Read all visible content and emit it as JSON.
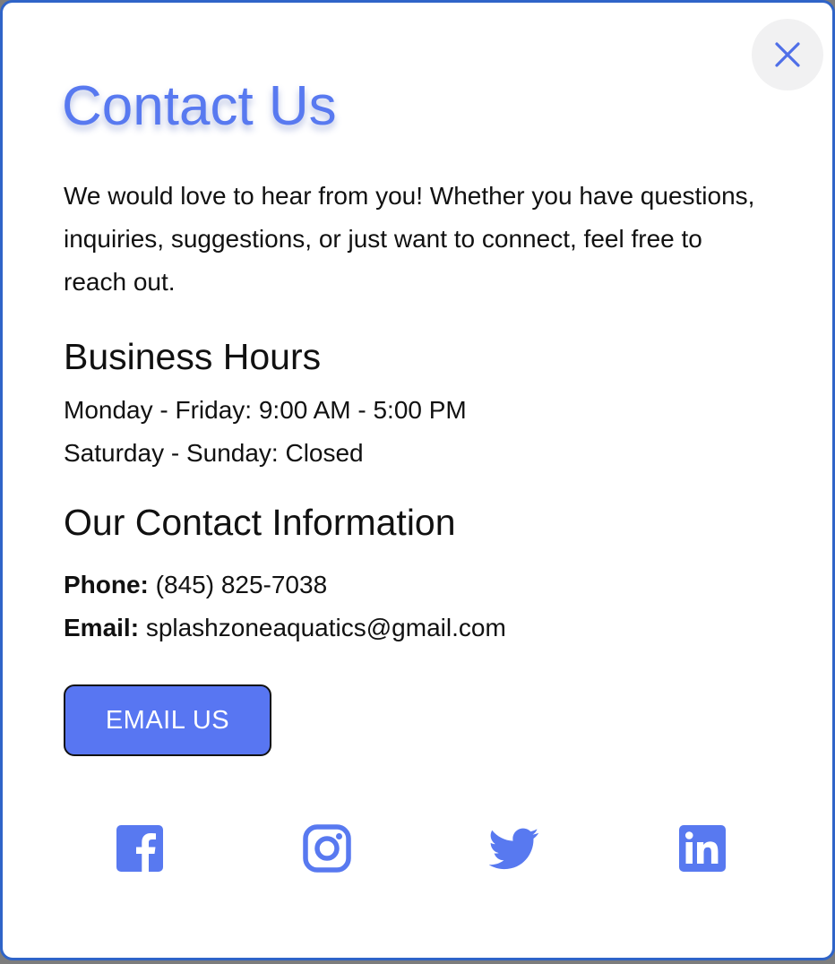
{
  "modal": {
    "title": "Contact Us",
    "intro": "We would love to hear from you! Whether you have questions, inquiries, suggestions, or just want to connect, feel free to reach out.",
    "close_icon": "close-icon"
  },
  "hours": {
    "title": "Business Hours",
    "weekdays": "Monday - Friday: 9:00 AM - 5:00 PM",
    "weekend": "Saturday - Sunday: Closed"
  },
  "contact": {
    "title": "Our Contact Information",
    "phone_label": "Phone:",
    "phone_value": "(845) 825-7038",
    "email_label": "Email:",
    "email_value": "splashzoneaquatics@gmail.com",
    "email_button": "EMAIL US"
  },
  "social": [
    {
      "icon": "facebook-icon"
    },
    {
      "icon": "instagram-icon"
    },
    {
      "icon": "twitter-icon"
    },
    {
      "icon": "linkedin-icon"
    }
  ],
  "colors": {
    "accent": "#5879f0",
    "border": "#2f64c8",
    "button": "#5876f2",
    "close_bg": "#f1f1f2"
  }
}
